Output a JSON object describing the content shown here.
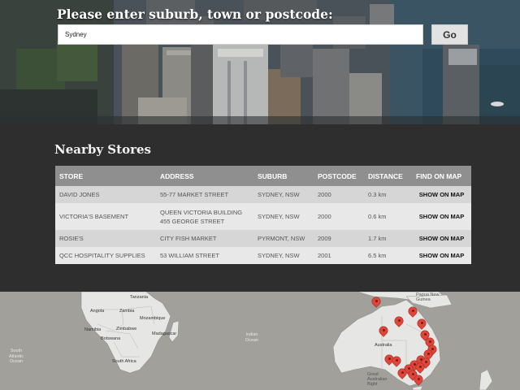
{
  "search": {
    "heading": "Please enter suburb, town or postcode:",
    "value": "Sydney",
    "go_label": "Go"
  },
  "stores": {
    "heading": "Nearby Stores",
    "columns": [
      "STORE",
      "ADDRESS",
      "SUBURB",
      "POSTCODE",
      "DISTANCE",
      "FIND ON MAP"
    ],
    "rows": [
      {
        "store": "DAVID JONES",
        "address": "55-77 MARKET STREET",
        "suburb": "SYDNEY, NSW",
        "postcode": "2000",
        "distance": "0.3 km",
        "link": "SHOW ON MAP"
      },
      {
        "store": "VICTORIA'S BASEMENT",
        "address": "QUEEN VICTORIA BUILDING 455 GEORGE STREET",
        "suburb": "SYDNEY, NSW",
        "postcode": "2000",
        "distance": "0.6 km",
        "link": "SHOW ON MAP"
      },
      {
        "store": "ROSIE'S",
        "address": "CITY FISH MARKET",
        "suburb": "PYRMONT, NSW",
        "postcode": "2009",
        "distance": "1.7 km",
        "link": "SHOW ON MAP"
      },
      {
        "store": "QCC HOSPITALITY SUPPLIES",
        "address": "53 WILLIAM STREET",
        "suburb": "SYDNEY, NSW",
        "postcode": "2001",
        "distance": "6.5 km",
        "link": "SHOW ON MAP"
      }
    ]
  },
  "map": {
    "labels": {
      "tanzania": "Tanzania",
      "angola": "Angola",
      "zambia": "Zambia",
      "mozambique": "Mozambique",
      "namibia": "Namibia",
      "zimbabwe": "Zimbabwe",
      "botswana": "Botswana",
      "madagascar": "Madagascar",
      "south_africa": "South Africa",
      "south_atlantic": "South Atlantic Ocean",
      "indian_ocean": "Indian Ocean",
      "australia": "Australia",
      "papua_new_guinea": "Papua New Guinea",
      "great_australian_bight": "Great Australian Bight"
    },
    "marker_color": "#e0453a",
    "land_color": "#e6e6e4",
    "water_color": "#a1a09b"
  }
}
